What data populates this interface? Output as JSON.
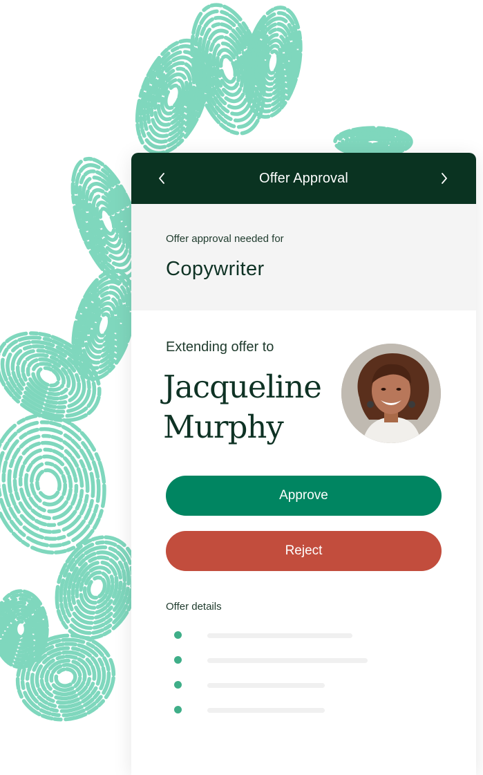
{
  "header": {
    "title": "Offer Approval",
    "prev_icon": "chevron-left-icon",
    "next_icon": "chevron-right-icon"
  },
  "job": {
    "eyebrow": "Offer approval needed for",
    "title": "Copywriter"
  },
  "candidate": {
    "extend_label": "Extending offer to",
    "first_name": "Jacqueline",
    "last_name": "Murphy"
  },
  "actions": {
    "approve_label": "Approve",
    "reject_label": "Reject"
  },
  "details": {
    "label": "Offer details",
    "item_count": 4
  },
  "colors": {
    "header_bg": "#0a3321",
    "approve": "#008561",
    "reject": "#c24d3d",
    "accent_dot": "#3fae88",
    "decor": "#7fd7bd"
  }
}
